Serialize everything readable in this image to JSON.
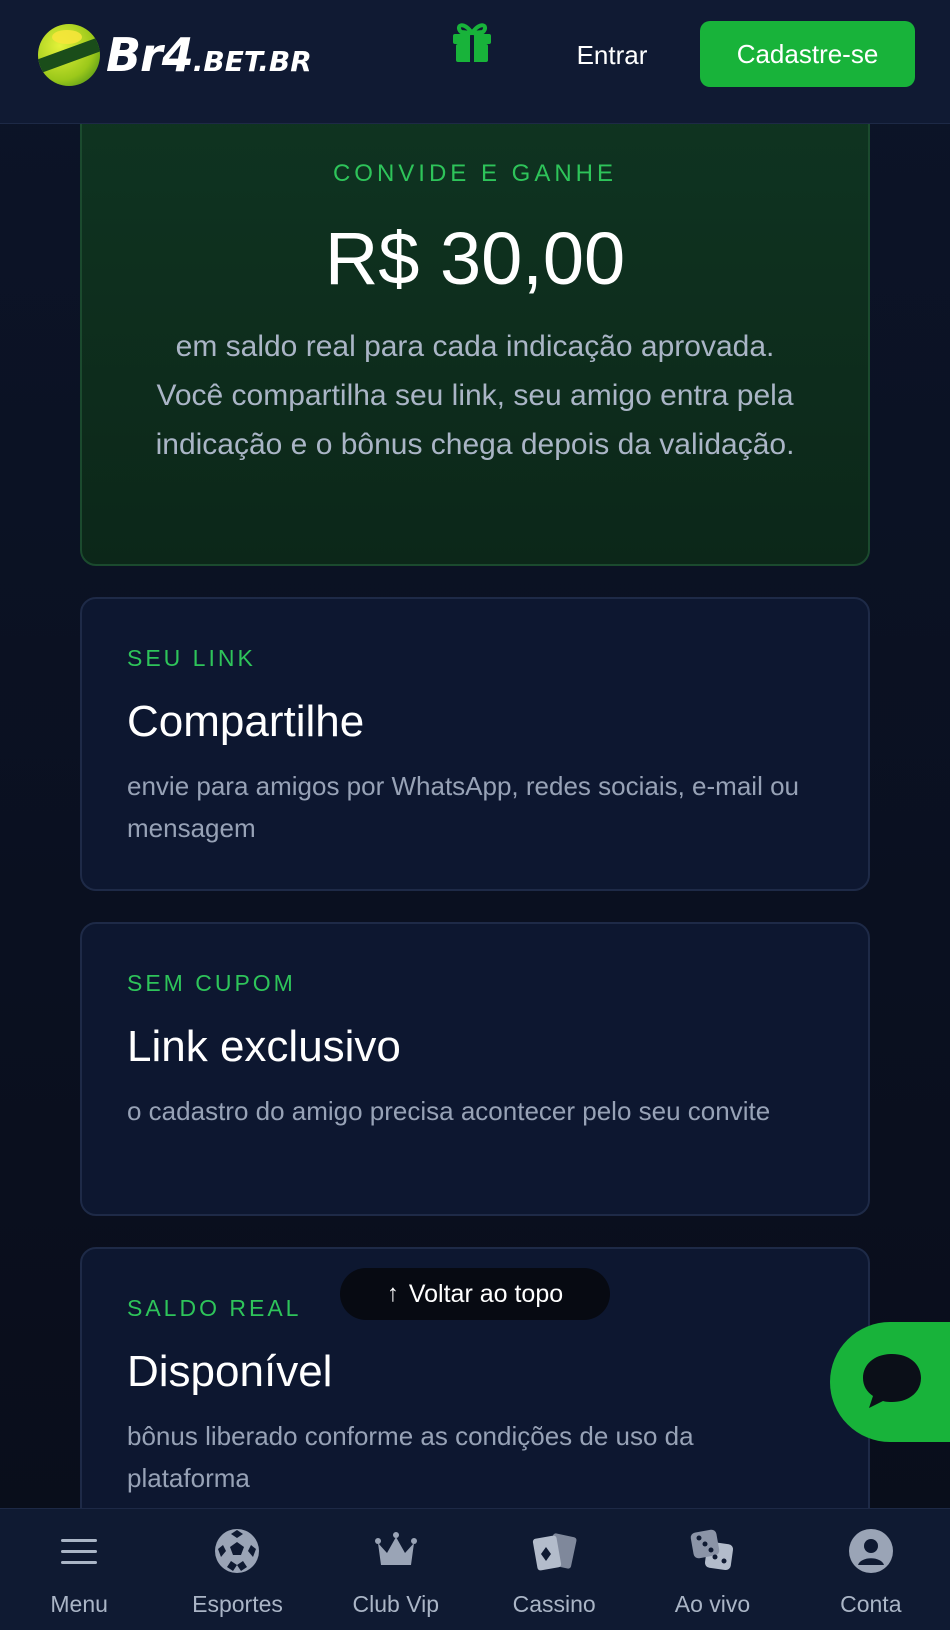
{
  "header": {
    "logo_main": "Br4",
    "logo_suffix": ".BET.BR",
    "login_label": "Entrar",
    "signup_label": "Cadastre-se"
  },
  "hero": {
    "eyebrow": "CONVIDE E GANHE",
    "amount": "R$ 30,00",
    "description": "em saldo real para cada indicação aprovada. Você compartilha seu link, seu amigo entra pela indicação e o bônus chega depois da validação."
  },
  "cards": [
    {
      "eyebrow": "SEU LINK",
      "title": "Compartilhe",
      "description": "envie para amigos por WhatsApp, redes sociais, e-mail ou mensagem"
    },
    {
      "eyebrow": "SEM CUPOM",
      "title": "Link exclusivo",
      "description": "o cadastro do amigo precisa acontecer pelo seu convite"
    },
    {
      "eyebrow": "SALDO REAL",
      "title": "Disponível",
      "description": "bônus liberado conforme as condições de uso da plataforma"
    }
  ],
  "back_to_top": {
    "label": "Voltar ao topo"
  },
  "bottom_nav": {
    "items": [
      {
        "label": "Menu",
        "icon": "menu-icon"
      },
      {
        "label": "Esportes",
        "icon": "soccer-ball-icon"
      },
      {
        "label": "Club Vip",
        "icon": "crown-icon"
      },
      {
        "label": "Cassino",
        "icon": "cards-icon"
      },
      {
        "label": "Ao vivo",
        "icon": "dice-icon"
      },
      {
        "label": "Conta",
        "icon": "user-icon"
      }
    ]
  },
  "colors": {
    "accent_green": "#18b33a",
    "eyebrow_green": "#2ec45a",
    "background": "#0a0f1e"
  }
}
